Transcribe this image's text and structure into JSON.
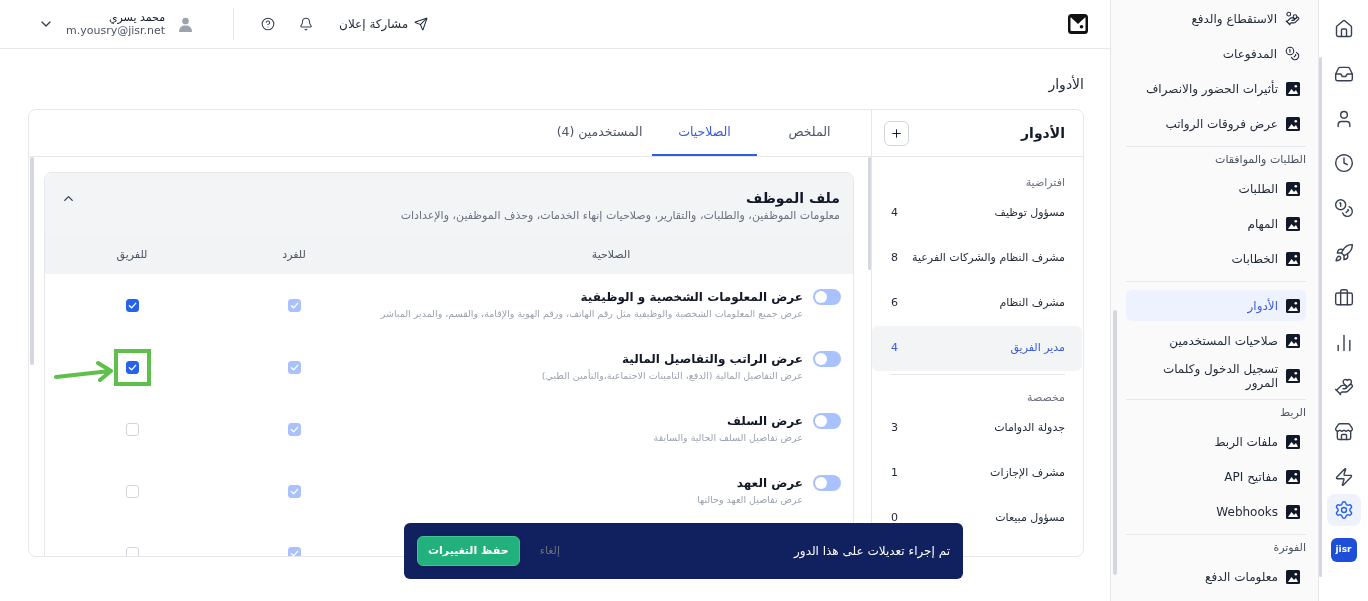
{
  "rail": {
    "items": [
      {
        "selected": false
      },
      {
        "selected": false
      },
      {
        "selected": false
      },
      {
        "selected": false
      },
      {
        "selected": false
      },
      {
        "selected": false
      },
      {
        "selected": false
      },
      {
        "selected": false
      },
      {
        "selected": false
      },
      {
        "selected": false
      },
      {
        "selected": false
      },
      {
        "selected": true
      }
    ],
    "logo_text": "jisr"
  },
  "sidebar": {
    "sections": [
      {
        "items": [
          {
            "label": "الاستقطاع والدفع",
            "selected": false
          },
          {
            "label": "المدفوعات",
            "selected": false
          },
          {
            "label": "تأثيرات الحضور والانصراف",
            "selected": false
          },
          {
            "label": "عرض فروقات الرواتب",
            "selected": false
          }
        ]
      },
      {
        "title": "الطلبات والموافقات",
        "items": [
          {
            "label": "الطلبات",
            "selected": false
          },
          {
            "label": "المهام",
            "selected": false
          },
          {
            "label": "الخطابات",
            "selected": false
          }
        ]
      },
      {
        "items": [
          {
            "label": "الأدوار",
            "selected": true
          },
          {
            "label": "صلاحيات المستخدمين",
            "selected": false
          },
          {
            "label": "تسجيل الدخول وكلمات المرور",
            "selected": false
          }
        ]
      },
      {
        "title": "الربط",
        "items": [
          {
            "label": "ملفات الربط",
            "selected": false
          },
          {
            "label": "مفاتيح API",
            "selected": false
          },
          {
            "label": "Webhooks",
            "selected": false
          }
        ]
      },
      {
        "title": "الفوترة",
        "items": [
          {
            "label": "معلومات الدفع",
            "selected": false
          }
        ]
      }
    ]
  },
  "header": {
    "share_label": "مشاركة إعلان",
    "user": {
      "name": "محمد يسري",
      "email": "m.yousry@jisr.net"
    }
  },
  "page_title": "الأدوار",
  "roles_panel": {
    "title": "الأدوار",
    "groups": [
      {
        "title": "افتراضية",
        "roles": [
          {
            "name": "مسؤول توظيف",
            "count": "4",
            "selected": false
          },
          {
            "name": "مشرف النظام والشركات الفرعية",
            "count": "8",
            "selected": false
          },
          {
            "name": "مشرف النظام",
            "count": "6",
            "selected": false
          },
          {
            "name": "مدير الفريق",
            "count": "4",
            "selected": true
          }
        ]
      },
      {
        "title": "مخصصة",
        "roles": [
          {
            "name": "جدولة الدوامات",
            "count": "3",
            "selected": false
          },
          {
            "name": "مشرف الإجازات",
            "count": "1",
            "selected": false
          },
          {
            "name": "مسؤول مبيعات",
            "count": "0",
            "selected": false
          }
        ]
      }
    ]
  },
  "tabs": [
    {
      "label": "الملخص",
      "selected": false
    },
    {
      "label": "الصلاحيات",
      "selected": true
    },
    {
      "label": "المستخدمين (4)",
      "selected": false
    }
  ],
  "permission_section": {
    "title": "ملف الموظف",
    "description": "معلومات الموظفين، والطلبات، والتقارير، وصلاحيات إنهاء الخدمات، وحذف الموظفين، والإعدادات",
    "expanded": true,
    "columns": [
      "الصلاحية",
      "للفرد",
      "للفريق"
    ],
    "rows": [
      {
        "title": "عرض المعلومات الشخصية و الوظيفية",
        "description": "عرض جميع المعلومات الشخصية والوظيفية مثل رقم الهاتف، ورقم الهوية والإقامة، والقسم، والمدير المباشر",
        "toggle": {
          "on": false,
          "disabled": true
        },
        "individual": {
          "checked": true,
          "disabled": true
        },
        "team": {
          "checked": true,
          "disabled": false,
          "highlighted": false
        }
      },
      {
        "title": "عرض الراتب والتفاصيل المالية",
        "description": "عرض التفاصيل المالية (الدفع، التامينات الاجتماعية،والتأمين الطبي)",
        "toggle": {
          "on": false,
          "disabled": true
        },
        "individual": {
          "checked": true,
          "disabled": true
        },
        "team": {
          "checked": true,
          "disabled": false,
          "highlighted": true
        }
      },
      {
        "title": "عرض السلف",
        "description": "عرض تفاصيل السلف الحالية والسابقة",
        "toggle": {
          "on": false,
          "disabled": true
        },
        "individual": {
          "checked": true,
          "disabled": true
        },
        "team": {
          "checked": false,
          "disabled": false,
          "highlighted": false
        }
      },
      {
        "title": "عرض العهد",
        "description": "عرض تفاصيل العهد وحالتها",
        "toggle": {
          "on": false,
          "disabled": true
        },
        "individual": {
          "checked": true,
          "disabled": true
        },
        "team": {
          "checked": false,
          "disabled": false,
          "highlighted": false
        }
      },
      {
        "individual": {
          "checked": true,
          "disabled": true
        },
        "team": {
          "checked": false,
          "disabled": false,
          "highlighted": false
        }
      }
    ]
  },
  "toast": {
    "message": "تم إجراء تعديلات على هذا الدور",
    "cancel": "إلغاء",
    "save": "حفظ التغييرات"
  }
}
